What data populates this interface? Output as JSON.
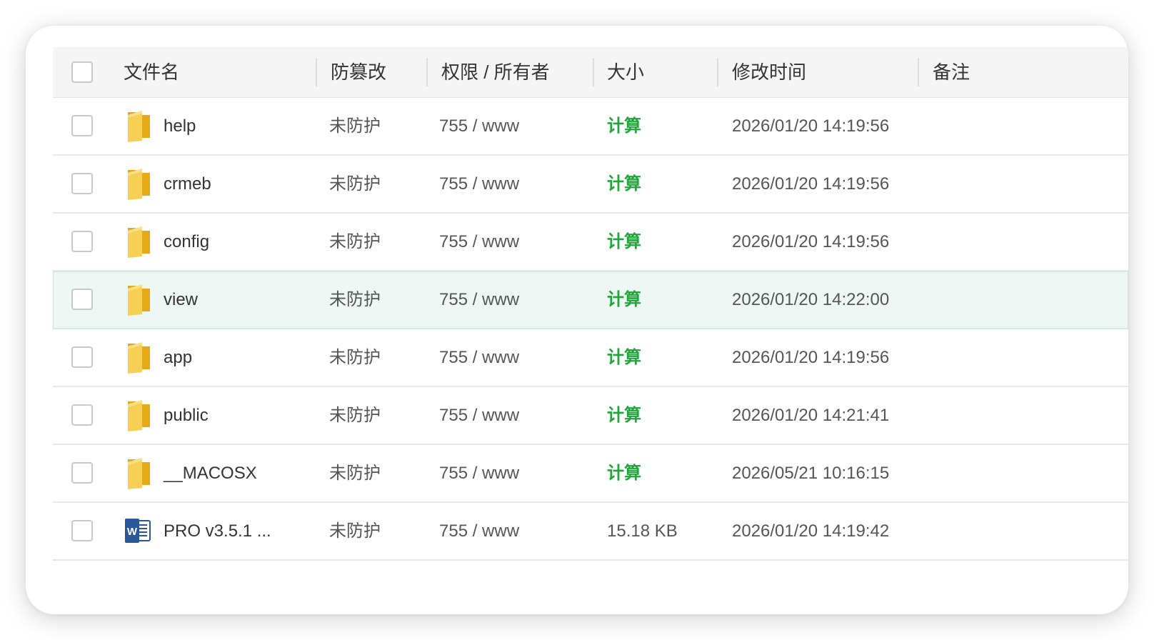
{
  "header": {
    "name": "文件名",
    "protect": "防篡改",
    "perm": "权限 / 所有者",
    "size": "大小",
    "mtime": "修改时间",
    "note": "备注"
  },
  "colors": {
    "link": "#20a53a",
    "selected_row": "#eef7f3",
    "folder": "#f5c444"
  },
  "rows": [
    {
      "type": "folder",
      "name": "help",
      "protect": "未防护",
      "perm": "755 / www",
      "size": "计算",
      "mtime": "2026/01/20 14:19:56",
      "note": ""
    },
    {
      "type": "folder",
      "name": "crmeb",
      "protect": "未防护",
      "perm": "755 / www",
      "size": "计算",
      "mtime": "2026/01/20 14:19:56",
      "note": ""
    },
    {
      "type": "folder",
      "name": "config",
      "protect": "未防护",
      "perm": "755 / www",
      "size": "计算",
      "mtime": "2026/01/20 14:19:56",
      "note": ""
    },
    {
      "type": "folder",
      "name": "view",
      "protect": "未防护",
      "perm": "755 / www",
      "size": "计算",
      "mtime": "2026/01/20 14:22:00",
      "note": "",
      "selected": true
    },
    {
      "type": "folder",
      "name": "app",
      "protect": "未防护",
      "perm": "755 / www",
      "size": "计算",
      "mtime": "2026/01/20 14:19:56",
      "note": ""
    },
    {
      "type": "folder",
      "name": "public",
      "protect": "未防护",
      "perm": "755 / www",
      "size": "计算",
      "mtime": "2026/01/20 14:21:41",
      "note": ""
    },
    {
      "type": "folder",
      "name": "__MACOSX",
      "protect": "未防护",
      "perm": "755 / www",
      "size": "计算",
      "mtime": "2026/05/21 10:16:15",
      "note": ""
    },
    {
      "type": "word",
      "name": "PRO v3.5.1 ...",
      "protect": "未防护",
      "perm": "755 / www",
      "size": "15.18 KB",
      "mtime": "2026/01/20 14:19:42",
      "note": ""
    }
  ]
}
